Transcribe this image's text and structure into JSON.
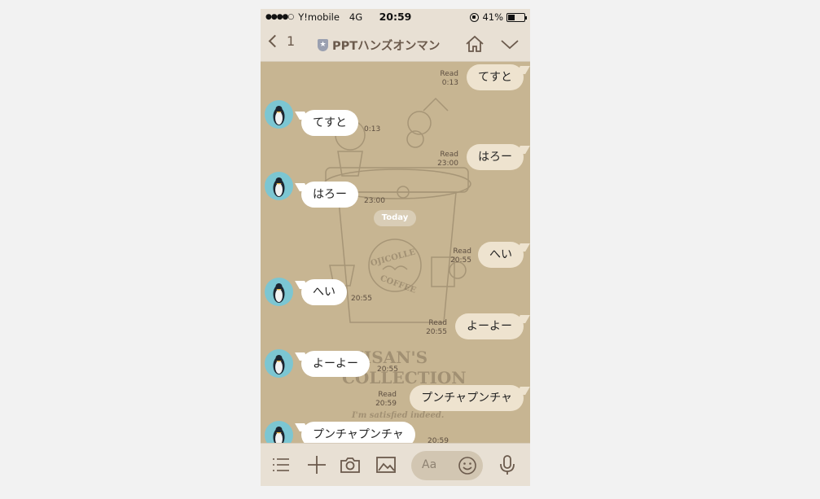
{
  "status": {
    "carrier": "Y!mobile",
    "network": "4G",
    "time": "20:59",
    "battery": "41%",
    "battery_level": 0.41
  },
  "header": {
    "back_count": "1",
    "title": "PPTハンズオンマン"
  },
  "chat": {
    "today_label": "Today",
    "messages": [
      {
        "dir": "out",
        "text": "てすと",
        "read": "Read",
        "time": "0:13"
      },
      {
        "dir": "in",
        "text": "てすと",
        "time": "0:13"
      },
      {
        "dir": "out",
        "text": "はろー",
        "read": "Read",
        "time": "23:00"
      },
      {
        "dir": "in",
        "text": "はろー",
        "time": "23:00"
      },
      {
        "dir": "out",
        "text": "へい",
        "read": "Read",
        "time": "20:55"
      },
      {
        "dir": "in",
        "text": "へい",
        "time": "20:55"
      },
      {
        "dir": "out",
        "text": "よーよー",
        "read": "Read",
        "time": "20:55"
      },
      {
        "dir": "in",
        "text": "よーよー",
        "time": "20:55"
      },
      {
        "dir": "out",
        "text": "プンチャプンチャ",
        "read": "Read",
        "time": "20:59"
      },
      {
        "dir": "in",
        "text": "プンチャプンチャ",
        "time": "20:59"
      }
    ]
  },
  "background": {
    "text_1": "OJICOLLE",
    "text_2": "COFFEE",
    "text_3": "OJISAN'S",
    "text_4": "COLLECTION",
    "text_5": "I'm satisfied indeed."
  },
  "toolbar": {
    "input_placeholder": "Aa"
  },
  "colors": {
    "chat_bg": "#c7b592",
    "bar_bg": "#e8e0d4",
    "outgoing_bubble": "#eee3cf",
    "incoming_bubble": "#ffffff",
    "accent_text": "#6b5a4c"
  }
}
